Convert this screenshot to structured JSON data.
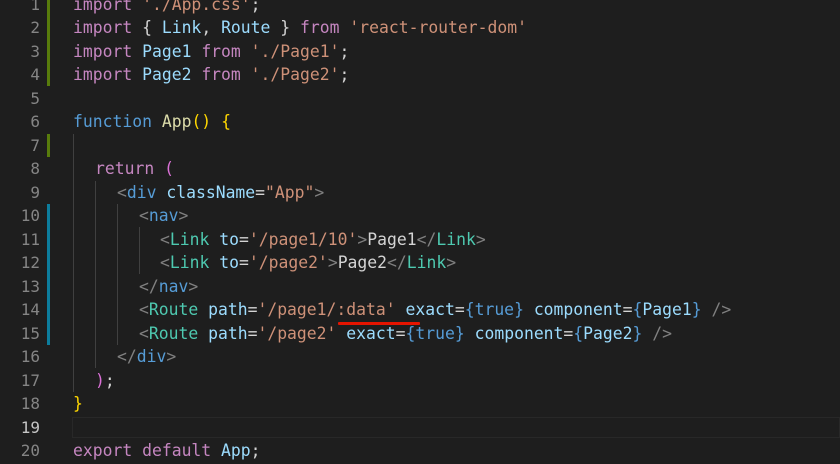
{
  "line_numbers": [
    "1",
    "2",
    "3",
    "4",
    "5",
    "6",
    "7",
    "8",
    "9",
    "10",
    "11",
    "12",
    "13",
    "14",
    "15",
    "16",
    "17",
    "18",
    "19",
    "20"
  ],
  "active_line": "19",
  "code": {
    "l1": {
      "kw": "import",
      "sp": " ",
      "str": "'./App.css'",
      "end": ";"
    },
    "l2": {
      "kw": "import",
      "a": " { ",
      "v1": "Link",
      "c": ", ",
      "v2": "Route",
      "b": " } ",
      "from": "from",
      "sp": " ",
      "str": "'react-router-dom'"
    },
    "l3": {
      "kw": "import",
      "sp": " ",
      "v": "Page1",
      "sp2": " ",
      "from": "from",
      "sp3": " ",
      "str": "'./Page1'",
      "end": ";"
    },
    "l4": {
      "kw": "import",
      "sp": " ",
      "v": "Page2",
      "sp2": " ",
      "from": "from",
      "sp3": " ",
      "str": "'./Page2'",
      "end": ";"
    },
    "l6": {
      "kw": "function",
      "sp": " ",
      "name": "App",
      "paren": "()",
      "sp2": " ",
      "brace": "{"
    },
    "l8": {
      "kw": "return",
      "sp": " ",
      "paren": "("
    },
    "l9": {
      "lt": "<",
      "tag": "div",
      "sp": " ",
      "attr": "className",
      "eq": "=",
      "str": "\"App\"",
      "gt": ">"
    },
    "l10": {
      "lt": "<",
      "tag": "nav",
      "gt": ">"
    },
    "l11": {
      "lt": "<",
      "cmp": "Link",
      "sp": " ",
      "attr": "to",
      "eq": "=",
      "str": "'/page1/10'",
      "gt": ">",
      "text": "Page1",
      "clt": "</",
      "ccmp": "Link",
      "cgt": ">"
    },
    "l12": {
      "lt": "<",
      "cmp": "Link",
      "sp": " ",
      "attr": "to",
      "eq": "=",
      "str": "'/page2'",
      "gt": ">",
      "text": "Page2",
      "clt": "</",
      "ccmp": "Link",
      "cgt": ">"
    },
    "l13": {
      "lt": "</",
      "tag": "nav",
      "gt": ">"
    },
    "l14": {
      "lt": "<",
      "cmp": "Route",
      "sp": " ",
      "attr1": "path",
      "eq1": "=",
      "str": "'/page1/:data'",
      "sp2": " ",
      "attr2": "exact",
      "eq2": "=",
      "ob1": "{",
      "val1": "true",
      "cb1": "}",
      "sp3": " ",
      "attr3": "component",
      "eq3": "=",
      "ob2": "{",
      "val2": "Page1",
      "cb2": "}",
      "sp4": " ",
      "close": "/>"
    },
    "l15": {
      "lt": "<",
      "cmp": "Route",
      "sp": " ",
      "attr1": "path",
      "eq1": "=",
      "str": "'/page2'",
      "sp2": " ",
      "attr2": "exact",
      "eq2": "=",
      "ob1": "{",
      "val1": "true",
      "cb1": "}",
      "sp3": " ",
      "attr3": "component",
      "eq3": "=",
      "ob2": "{",
      "val2": "Page2",
      "cb2": "}",
      "sp4": " ",
      "close": "/>"
    },
    "l16": {
      "lt": "</",
      "tag": "div",
      "gt": ">"
    },
    "l17": {
      "paren": ")",
      "end": ";"
    },
    "l18": {
      "brace": "}"
    },
    "l20": {
      "kw1": "export",
      "sp": " ",
      "kw2": "default",
      "sp2": " ",
      "name": "App",
      "end": ";"
    }
  },
  "colors": {
    "background": "#1e1e1e",
    "keyword_control": "#c586c0",
    "keyword_storage": "#569cd6",
    "string": "#ce9178",
    "variable": "#9cdcfe",
    "component": "#4ec9b0",
    "function": "#dcdcaa",
    "error_squiggle": "#e51400",
    "git_modified": "#0c7d9d",
    "git_added": "#587c0c"
  }
}
